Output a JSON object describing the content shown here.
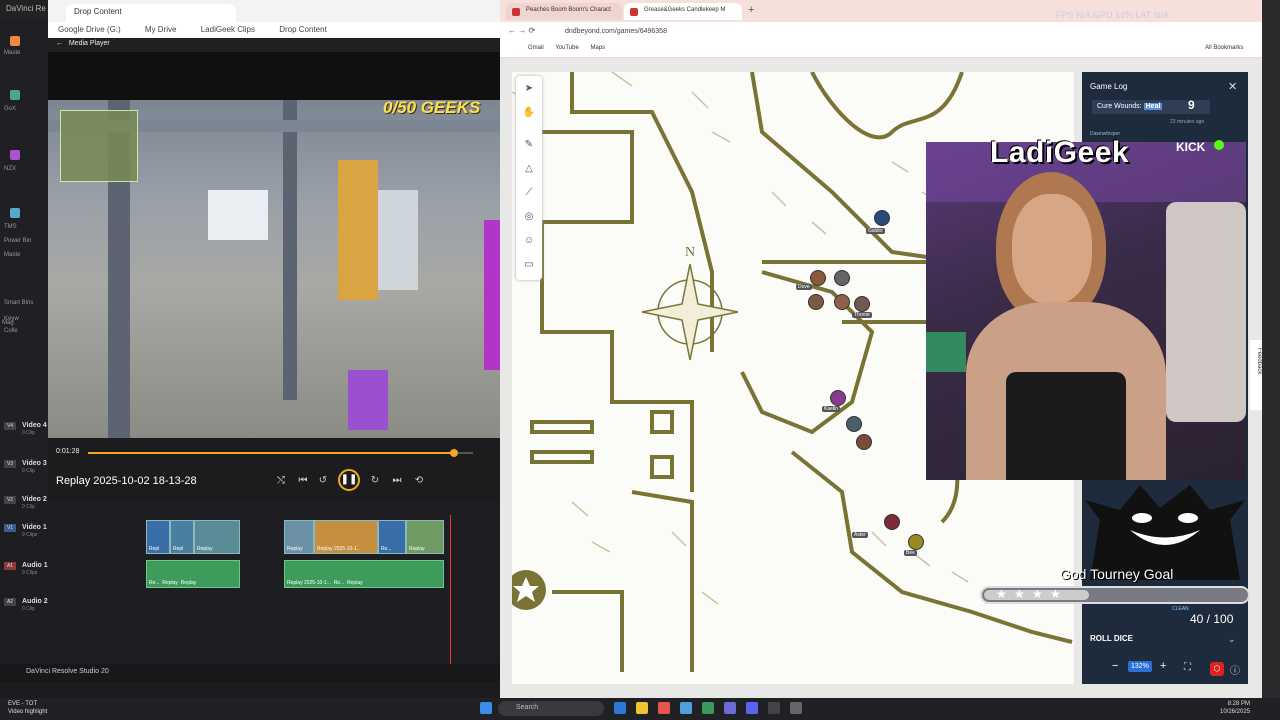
{
  "resolve": {
    "top_title": "DaVinci Re",
    "left_labels": [
      "Maste",
      "GoX",
      "NZX",
      "TMS",
      "Power Bin",
      "Maste",
      "Smart Bins",
      "Keyw",
      "Colle",
      "Mag"
    ],
    "footer": "DaVinci Resolve Studio 20"
  },
  "browser1": {
    "tab": "Drop Content",
    "breadcrumbs": [
      "Google Drive (G:)",
      "My Drive",
      "LadiGeek Clips",
      "Drop Content"
    ]
  },
  "media_player": {
    "title": "Media Player",
    "game_banner": "0/50 GEEKS",
    "current_time": "0:01:28",
    "progress": 0.95,
    "clip_name": "Replay 2025-10-02 18-13-28"
  },
  "timeline": {
    "tracks": [
      {
        "tag": "V4",
        "name": "Video 4",
        "clips": "0 Clip"
      },
      {
        "tag": "V3",
        "name": "Video 3",
        "clips": "0 Clip"
      },
      {
        "tag": "V2",
        "name": "Video 2",
        "clips": "0 Clip"
      },
      {
        "tag": "V1",
        "name": "Video 1",
        "clips": "9 Clips"
      },
      {
        "tag": "A1",
        "name": "Audio 1",
        "clips": "9 Clips"
      },
      {
        "tag": "A2",
        "name": "Audio 2",
        "clips": "0 Clip"
      }
    ],
    "clip_labels": [
      "Repl",
      "Repl",
      "Replay",
      "Replay",
      "Re...",
      "Replay 2025-10-1...",
      "Re...",
      "Replay"
    ]
  },
  "browser2": {
    "tabs": [
      "Peaches Boom Boom's Charact",
      "Grease&Geeks Candlekeep M"
    ],
    "url": "dndbeyond.com/games/6496358",
    "bookmarks": [
      "Gmail",
      "YouTube",
      "Maps"
    ],
    "all_bookmarks": "All Bookmarks"
  },
  "hud": "FPS N/A   GPU 14%   LAT N/A",
  "game_log": {
    "title": "Game Log",
    "roll_label": "Cure Wounds:",
    "roll_type": "Heal",
    "roll_value": "9",
    "time": "23 minutes ago",
    "user": "Dawnwhisper"
  },
  "stream": {
    "name": "LadiGeek",
    "platform": "KICK",
    "goal_title": "God Tourney Goal",
    "goal_count": "40 / 100",
    "goal_fraction": 0.4,
    "clean": "CLEAN"
  },
  "map_controls": {
    "roll_dice": "ROLL DICE",
    "zoom": "132%",
    "feedback": "Feedback"
  },
  "tokens": [
    "Galdor",
    "Dove",
    "Thorne",
    "Kaelin",
    "Aster",
    "Bee"
  ],
  "taskbar": {
    "app_line1": "EVE - TOT",
    "app_line2": "Video highlight",
    "search": "Search",
    "time": "8:28 PM",
    "date": "10/26/2025"
  }
}
